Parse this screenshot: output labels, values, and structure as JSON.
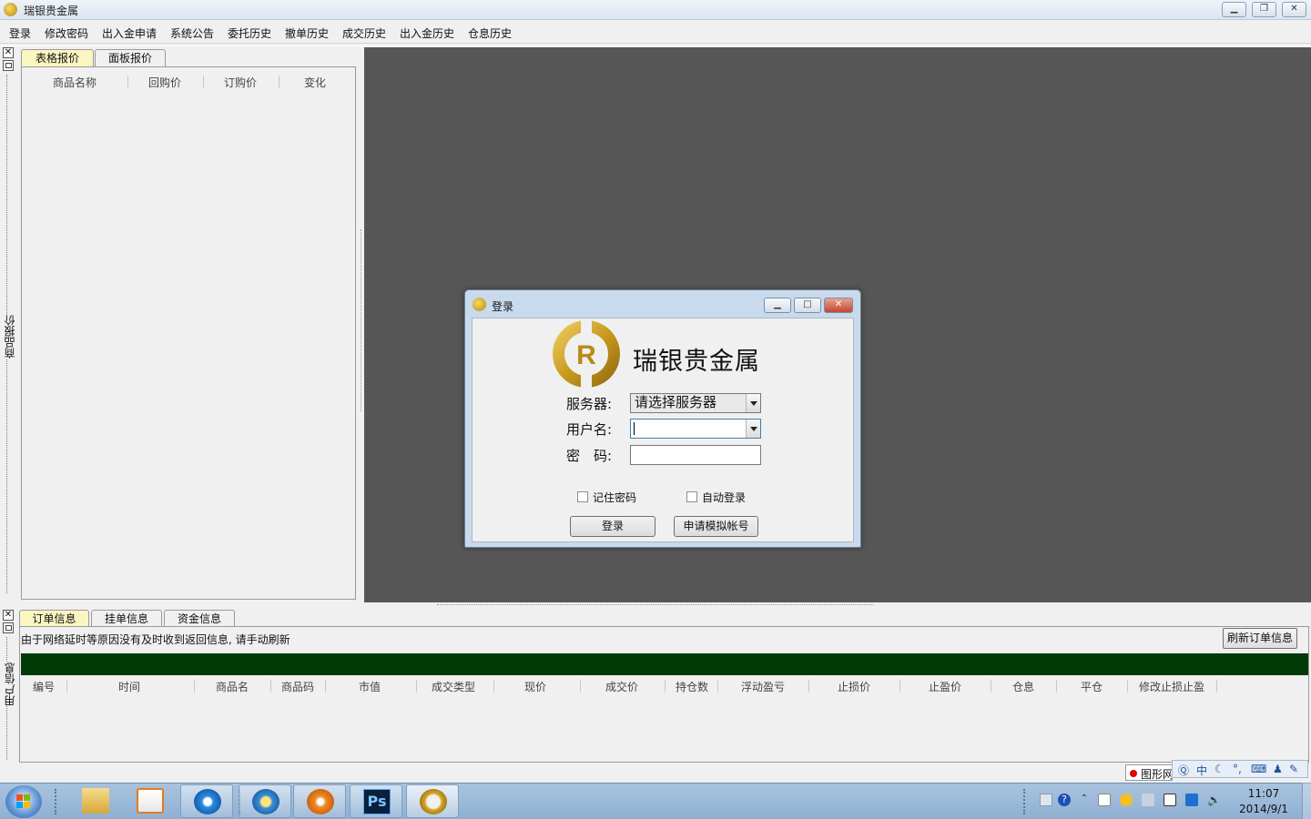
{
  "window": {
    "title": "瑞银贵金属"
  },
  "menu": [
    "登录",
    "修改密码",
    "出入金申请",
    "系统公告",
    "委托历史",
    "撤单历史",
    "成交历史",
    "出入金历史",
    "仓息历史"
  ],
  "left_dock": {
    "label": "商品报价",
    "tabs": [
      "表格报价",
      "面板报价"
    ],
    "columns": [
      "商品名称",
      "回购价",
      "订购价",
      "变化"
    ]
  },
  "login_dialog": {
    "title": "登录",
    "brand": "瑞银贵金属",
    "server_label": "服务器:",
    "server_value": "请选择服务器",
    "username_label": "用户名:",
    "username_value": "",
    "password_label": "密　码:",
    "password_value": "",
    "remember_label": "记住密码",
    "autologin_label": "自动登录",
    "login_button": "登录",
    "demo_button": "申请模拟帐号"
  },
  "bottom_dock": {
    "label": "用户信息",
    "tabs": [
      "订单信息",
      "挂单信息",
      "资金信息"
    ],
    "notice": "由于网络延时等原因没有及时收到返回信息, 请手动刷新",
    "refresh_button": "刷新订单信息",
    "columns": [
      "编号",
      "时间",
      "商品名",
      "商品码",
      "市值",
      "成交类型",
      "现价",
      "成交价",
      "持仓数",
      "浮动盈亏",
      "止损价",
      "止盈价",
      "仓息",
      "平仓",
      "修改止损止盈"
    ]
  },
  "ime": {
    "mode": "中",
    "tooltip_fragment": "图形网"
  },
  "clock": {
    "time": "11:07",
    "date": "2014/9/1"
  },
  "colors": {
    "main_area": "#565656",
    "green_bar": "#003a05",
    "active_tab": "#fbf5c0",
    "brand_gold": "#c8a020"
  }
}
